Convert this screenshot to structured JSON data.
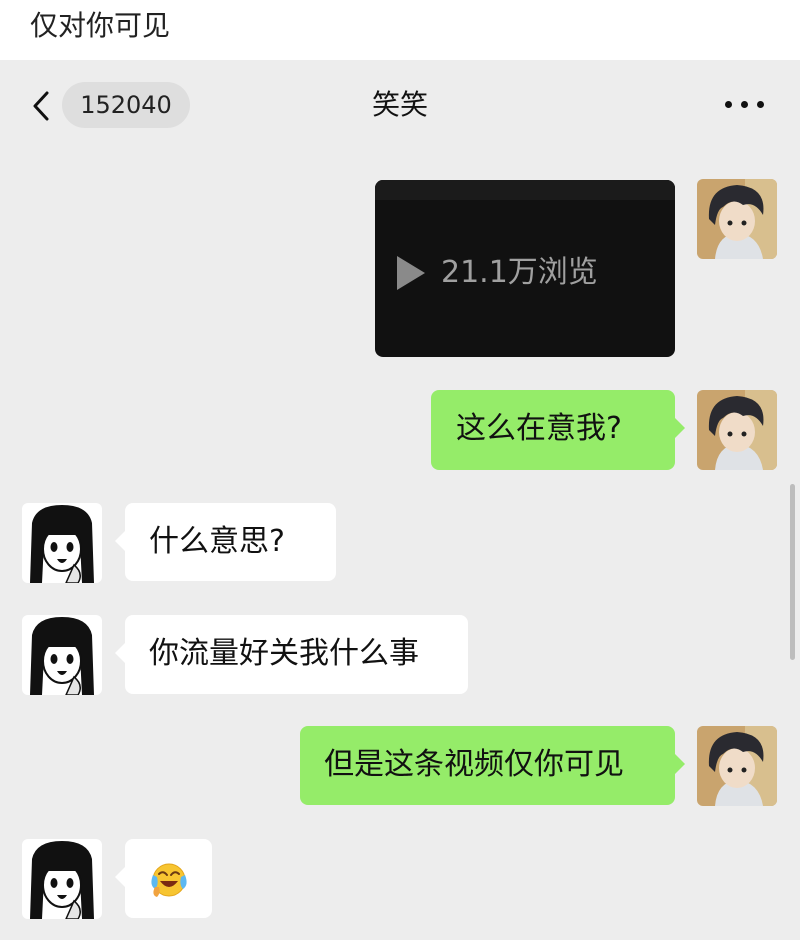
{
  "caption": "仅对你可见",
  "header": {
    "back_icon": "chevron-left-icon",
    "unread_count": "152040",
    "title": "笑笑",
    "more_icon": "ellipsis-icon"
  },
  "messages": [
    {
      "side": "right",
      "type": "video",
      "views": "21.1万浏览",
      "icon": "play-icon"
    },
    {
      "side": "right",
      "type": "text",
      "text": "这么在意我?"
    },
    {
      "side": "left",
      "type": "text",
      "text": "什么意思?"
    },
    {
      "side": "left",
      "type": "text",
      "text": "你流量好关我什么事"
    },
    {
      "side": "right",
      "type": "text",
      "text": "但是这条视频仅你可见"
    },
    {
      "side": "left",
      "type": "emoji",
      "icon": "laughing-crying-emoji-icon"
    }
  ],
  "colors": {
    "sent_bubble": "#95ec69",
    "received_bubble": "#ffffff",
    "chat_background": "#ededed"
  }
}
